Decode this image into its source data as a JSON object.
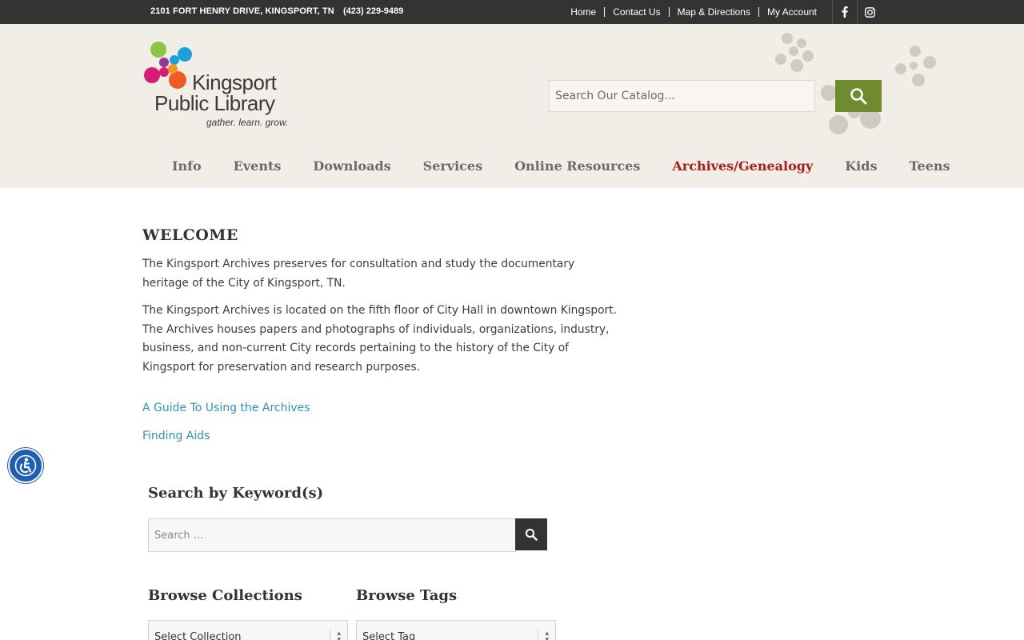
{
  "topbar": {
    "address": "2101 FORT HENRY DRIVE, KINGSPORT, TN",
    "phone": "(423) 229-9489",
    "links": [
      "Home",
      "Contact Us",
      "Map & Directions",
      "My Account"
    ],
    "social": [
      "facebook-icon",
      "instagram-icon"
    ]
  },
  "header": {
    "logo_line1": "Kingsport",
    "logo_line2": "Public Library",
    "logo_tagline": "gather. learn. grow.",
    "catalog_search_placeholder": "Search Our Catalog...",
    "catalog_search_icon": "search-icon",
    "nav": [
      "Info",
      "Events",
      "Downloads",
      "Services",
      "Online Resources",
      "Archives/Genealogy",
      "Kids",
      "Teens"
    ],
    "active_nav": "Archives/Genealogy"
  },
  "content": {
    "title": "WELCOME",
    "para1": "The Kingsport Archives preserves for consultation and study the documentary heritage of the City of Kingsport, TN.",
    "para2": "The Kingsport Archives is located on the fifth floor of City Hall in downtown Kingsport. The Archives houses papers and photographs of individuals, organizations, industry, business, and non-current City records pertaining to the history of the City of Kingsport for preservation and research purposes.",
    "link1": "A Guide To Using the Archives",
    "link2": "Finding Aids",
    "keyword_heading": "Search by Keyword(s)",
    "keyword_placeholder": "Search ...",
    "collections_heading": "Browse Collections",
    "collections_select": "Select Collection",
    "tags_heading": "Browse Tags",
    "tags_select": "Select Tag"
  },
  "colors": {
    "topbar": "#333333",
    "header_bg": "#f1eee8",
    "search_button": "#6e8c2d",
    "active_nav": "#a81c1c",
    "link": "#2b93c3",
    "accessibility": "#1d5fb5"
  }
}
